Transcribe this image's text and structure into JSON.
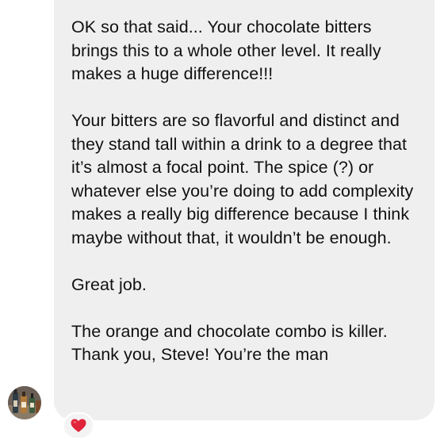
{
  "message": {
    "paragraphs": [
      "OK so that said... Your chocolate bitters brings this to a whole other level. It really makes a huge difference!!!",
      "Your bitters are so flavorful and distinct and they stand tall within a drink to a degree that it’s almost a focal point. The spice (?) or whatever else you’re doing to add complexity makes a really big difference because I think maybe without that, it wouldn’t be enough.",
      "Great job.",
      "The orange and chocolate combo is killer. Thank you, Steve! You’re the man"
    ]
  },
  "sender": {
    "avatar_icon": "sender-avatar-photo"
  },
  "reaction": {
    "icon": "red-heart-icon",
    "color": "#e0243a"
  },
  "colors": {
    "bubble_background": "#efefef",
    "text": "#111111",
    "page_background": "#ffffff"
  }
}
